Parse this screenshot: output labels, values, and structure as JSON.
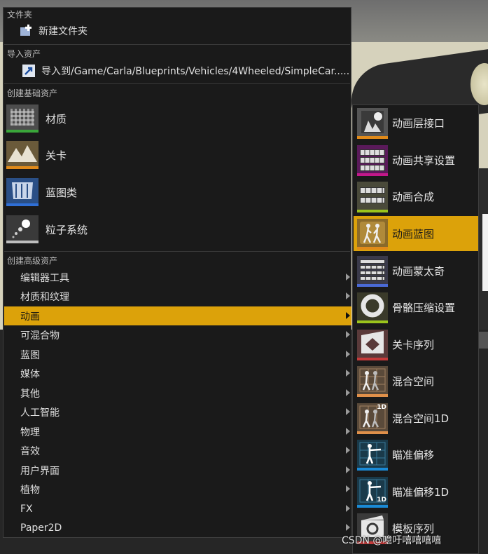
{
  "main_menu": {
    "sections": {
      "folder": "文件夹",
      "import": "导入资产",
      "basic": "创建基础资产",
      "advanced": "创建高级资产"
    },
    "new_folder": "新建文件夹",
    "import_to": "导入到/Game/Carla/Blueprints/Vehicles/4Wheeled/SimpleCar.....",
    "basic_assets": [
      {
        "label": "材质",
        "icon": "material-icon",
        "bar_color": "#3aa63a"
      },
      {
        "label": "关卡",
        "icon": "level-icon",
        "bar_color": "#e08a1a"
      },
      {
        "label": "蓝图类",
        "icon": "blueprint-icon",
        "bar_color": "#2f6fd6"
      },
      {
        "label": "粒子系统",
        "icon": "particle-icon",
        "bar_color": "#bdbdbd"
      }
    ],
    "advanced_assets": [
      {
        "label": "编辑器工具"
      },
      {
        "label": "材质和纹理"
      },
      {
        "label": "动画",
        "active": true
      },
      {
        "label": "可混合物"
      },
      {
        "label": "蓝图"
      },
      {
        "label": "媒体"
      },
      {
        "label": "其他"
      },
      {
        "label": "人工智能"
      },
      {
        "label": "物理"
      },
      {
        "label": "音效"
      },
      {
        "label": "用户界面"
      },
      {
        "label": "植物"
      },
      {
        "label": "FX"
      },
      {
        "label": "Paper2D"
      }
    ]
  },
  "animation_submenu": [
    {
      "label": "动画层接口",
      "icon": "anim-layer-interface-icon",
      "bar_color": "#e08a1a"
    },
    {
      "label": "动画共享设置",
      "icon": "anim-sharing-icon",
      "bar_color": "#c2188a"
    },
    {
      "label": "动画合成",
      "icon": "anim-composite-icon",
      "bar_color": "#9bc41c"
    },
    {
      "label": "动画蓝图",
      "icon": "anim-blueprint-icon",
      "bar_color": "#e08a1a",
      "active": true
    },
    {
      "label": "动画蒙太奇",
      "icon": "anim-montage-icon",
      "bar_color": "#4a6ad6"
    },
    {
      "label": "骨骼压缩设置",
      "icon": "bone-compression-icon",
      "bar_color": "#9bc41c"
    },
    {
      "label": "关卡序列",
      "icon": "level-sequence-icon",
      "bar_color": "#c43a3a"
    },
    {
      "label": "混合空间",
      "icon": "blendspace-icon",
      "bar_color": "#e0904a"
    },
    {
      "label": "混合空间1D",
      "icon": "blendspace-1d-icon",
      "bar_color": "#e0904a",
      "badge": "1D"
    },
    {
      "label": "瞄准偏移",
      "icon": "aim-offset-icon",
      "bar_color": "#1a8ad6"
    },
    {
      "label": "瞄准偏移1D",
      "icon": "aim-offset-1d-icon",
      "bar_color": "#1a8ad6",
      "badge": "1D"
    },
    {
      "label": "模板序列",
      "icon": "template-sequence-icon",
      "bar_color": "#c43a3a"
    }
  ],
  "watermark": "CSDN @噫吁嘻嘻嘻嘻"
}
